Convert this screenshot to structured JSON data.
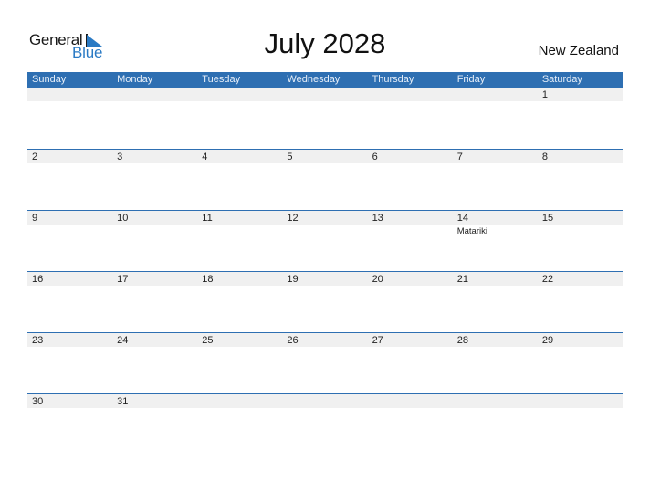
{
  "logo": {
    "general": "General",
    "blue": "Blue",
    "icon": "triangle-flag-icon",
    "accent_color": "#2a7ac4"
  },
  "title": "July 2028",
  "country": "New Zealand",
  "colors": {
    "header_bg": "#2e6fb2",
    "header_text": "#e6eef8",
    "date_band": "#f0f0f0"
  },
  "weekdays": [
    "Sunday",
    "Monday",
    "Tuesday",
    "Wednesday",
    "Thursday",
    "Friday",
    "Saturday"
  ],
  "weeks": [
    [
      {
        "day": ""
      },
      {
        "day": ""
      },
      {
        "day": ""
      },
      {
        "day": ""
      },
      {
        "day": ""
      },
      {
        "day": ""
      },
      {
        "day": "1"
      }
    ],
    [
      {
        "day": "2"
      },
      {
        "day": "3"
      },
      {
        "day": "4"
      },
      {
        "day": "5"
      },
      {
        "day": "6"
      },
      {
        "day": "7"
      },
      {
        "day": "8"
      }
    ],
    [
      {
        "day": "9"
      },
      {
        "day": "10"
      },
      {
        "day": "11"
      },
      {
        "day": "12"
      },
      {
        "day": "13"
      },
      {
        "day": "14",
        "holiday": "Matariki"
      },
      {
        "day": "15"
      }
    ],
    [
      {
        "day": "16"
      },
      {
        "day": "17"
      },
      {
        "day": "18"
      },
      {
        "day": "19"
      },
      {
        "day": "20"
      },
      {
        "day": "21"
      },
      {
        "day": "22"
      }
    ],
    [
      {
        "day": "23"
      },
      {
        "day": "24"
      },
      {
        "day": "25"
      },
      {
        "day": "26"
      },
      {
        "day": "27"
      },
      {
        "day": "28"
      },
      {
        "day": "29"
      }
    ],
    [
      {
        "day": "30"
      },
      {
        "day": "31"
      },
      {
        "day": ""
      },
      {
        "day": ""
      },
      {
        "day": ""
      },
      {
        "day": ""
      },
      {
        "day": ""
      }
    ]
  ]
}
